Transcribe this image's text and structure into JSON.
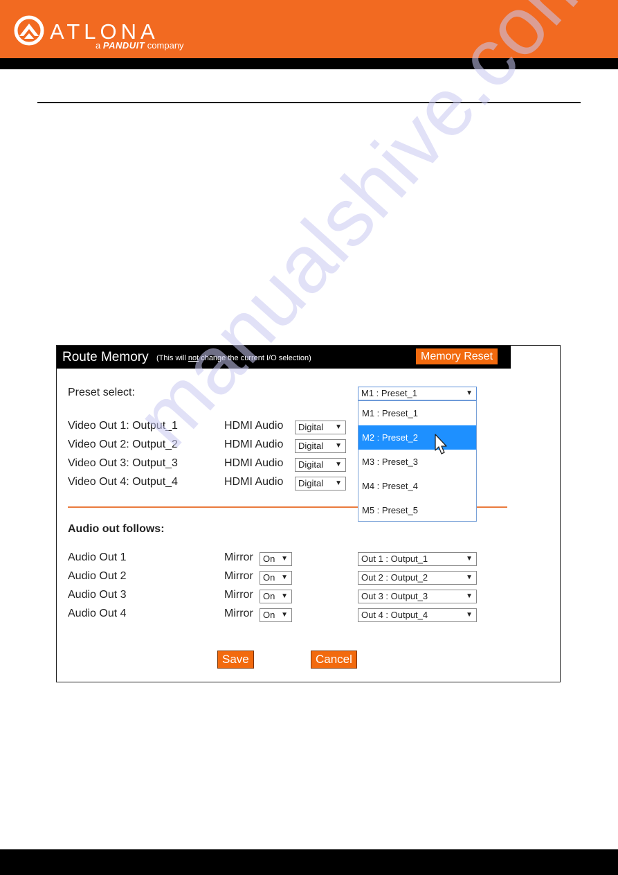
{
  "header": {
    "brand_name": "ATLONA",
    "tagline_prefix": "a",
    "tagline_brand": "PANDUIT",
    "tagline_suffix": "company",
    "colors": {
      "brand_orange": "#f26a21",
      "strip": "#000000"
    }
  },
  "watermark": {
    "text": "manualshive.com"
  },
  "route_memory": {
    "title": "Route Memory",
    "note_prefix": "(This will ",
    "note_emphasis": "not",
    "note_suffix": " change the current I/O selection)",
    "memory_reset_label": "Memory Reset",
    "preset_label": "Preset select:",
    "preset_selected": "M1 : Preset_1",
    "preset_options": [
      {
        "label": "M1 : Preset_1",
        "highlighted": false
      },
      {
        "label": "M2 : Preset_2",
        "highlighted": true
      },
      {
        "label": "M3 : Preset_3",
        "highlighted": false
      },
      {
        "label": "M4 : Preset_4",
        "highlighted": false
      },
      {
        "label": "M5 : Preset_5",
        "highlighted": false
      }
    ],
    "video_outputs": [
      {
        "label": "Video Out 1: Output_1",
        "audio_label": "HDMI Audio",
        "audio_value": "Digital"
      },
      {
        "label": "Video Out 2: Output_2",
        "audio_label": "HDMI Audio",
        "audio_value": "Digital"
      },
      {
        "label": "Video Out 3: Output_3",
        "audio_label": "HDMI Audio",
        "audio_value": "Digital"
      },
      {
        "label": "Video Out 4: Output_4",
        "audio_label": "HDMI Audio",
        "audio_value": "Digital"
      }
    ],
    "audio_section_title": "Audio out follows:",
    "audio_outputs": [
      {
        "label": "Audio Out 1",
        "mirror_label": "Mirror",
        "mirror_value": "On",
        "follow_value": "Out 1 : Output_1"
      },
      {
        "label": "Audio Out 2",
        "mirror_label": "Mirror",
        "mirror_value": "On",
        "follow_value": "Out 2 : Output_2"
      },
      {
        "label": "Audio Out 3",
        "mirror_label": "Mirror",
        "mirror_value": "On",
        "follow_value": "Out 3 : Output_3"
      },
      {
        "label": "Audio Out 4",
        "mirror_label": "Mirror",
        "mirror_value": "On",
        "follow_value": "Out 4 : Output_4"
      }
    ],
    "save_label": "Save",
    "cancel_label": "Cancel",
    "colors": {
      "accent": "#f26a0e",
      "highlight": "#1e90ff",
      "divider": "#ea7a3d"
    }
  },
  "icons": {
    "dropdown_arrow": "▼"
  }
}
